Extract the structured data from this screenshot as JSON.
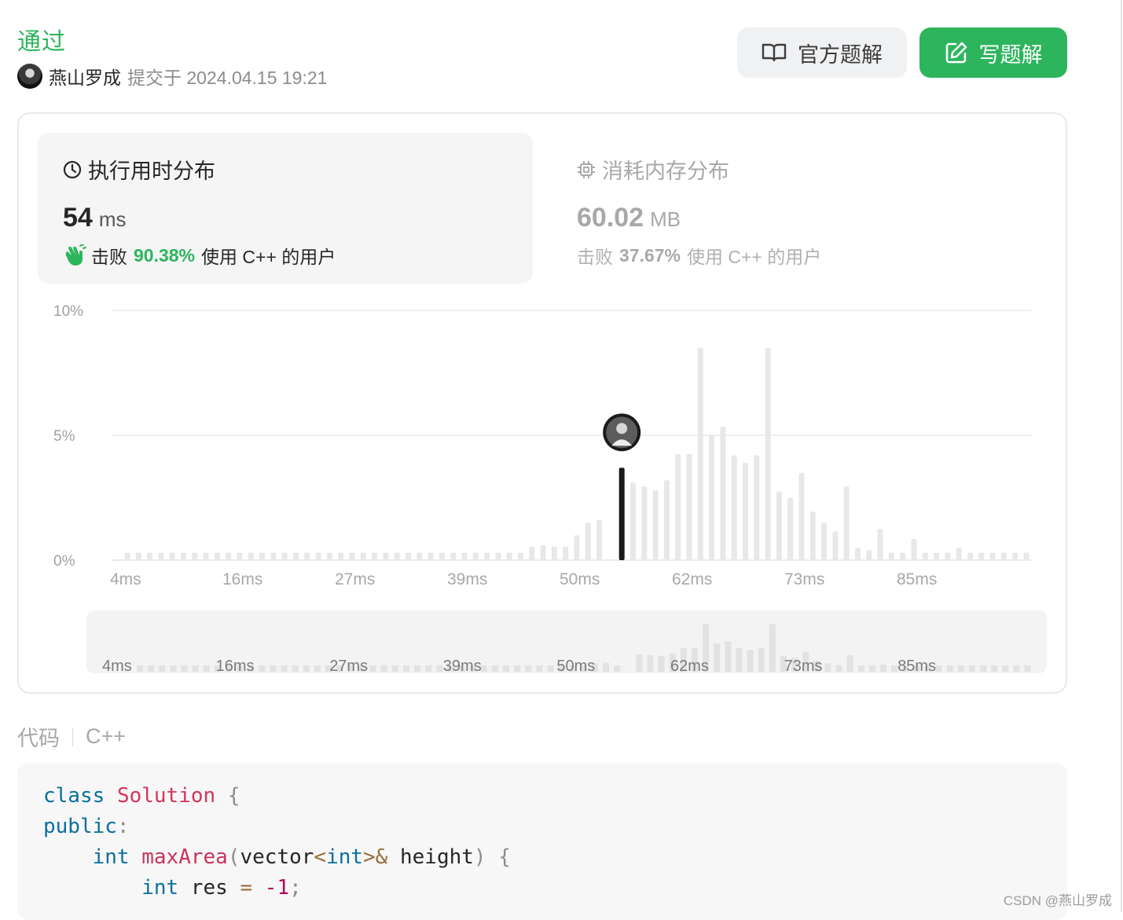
{
  "status": "通过",
  "submission": {
    "author": "燕山罗成",
    "submitted_text": "提交于 2024.04.15 19:21"
  },
  "buttons": {
    "official_solution": "官方题解",
    "write_solution": "写题解"
  },
  "runtime": {
    "title": "执行用时分布",
    "value": "54",
    "unit": "ms",
    "beat_prefix": "击败",
    "beat_percent": "90.38%",
    "beat_suffix": "使用 C++ 的用户"
  },
  "memory": {
    "title": "消耗内存分布",
    "value": "60.02",
    "unit": "MB",
    "beat_prefix": "击败",
    "beat_percent": "37.67%",
    "beat_suffix": "使用 C++ 的用户"
  },
  "chart_data": {
    "type": "bar",
    "y_ticks": [
      "10%",
      "5%",
      "0%"
    ],
    "ylim": [
      0,
      10
    ],
    "x_tick_labels": [
      "4ms",
      "16ms",
      "27ms",
      "39ms",
      "50ms",
      "62ms",
      "73ms",
      "85ms"
    ],
    "highlight_index": 44,
    "highlight_color": "#1a1a1a",
    "bar_color": "#e8e8e8",
    "values": [
      0.3,
      0.3,
      0.3,
      0.3,
      0.3,
      0.3,
      0.3,
      0.3,
      0.3,
      0.3,
      0.3,
      0.3,
      0.3,
      0.3,
      0.3,
      0.3,
      0.3,
      0.3,
      0.3,
      0.3,
      0.3,
      0.3,
      0.3,
      0.3,
      0.3,
      0.3,
      0.3,
      0.3,
      0.3,
      0.3,
      0.3,
      0.3,
      0.3,
      0.3,
      0.3,
      0.3,
      0.55,
      0.6,
      0.55,
      0.55,
      1.0,
      1.5,
      1.6,
      0.0,
      3.7,
      3.1,
      2.95,
      2.8,
      3.2,
      4.25,
      4.25,
      8.5,
      5.0,
      5.35,
      4.2,
      3.9,
      4.2,
      8.5,
      2.75,
      2.5,
      3.5,
      1.95,
      1.5,
      1.15,
      2.95,
      0.5,
      0.4,
      1.25,
      0.3,
      0.3,
      0.85,
      0.3,
      0.3,
      0.3,
      0.5,
      0.3,
      0.3,
      0.3,
      0.3,
      0.3,
      0.3
    ]
  },
  "code": {
    "header_label": "代码",
    "language": "C++",
    "lines": [
      [
        {
          "t": "class",
          "c": "kw"
        },
        {
          "t": " "
        },
        {
          "t": "Solution",
          "c": "cls"
        },
        {
          "t": " {",
          "c": "punc"
        }
      ],
      [
        {
          "t": "public",
          "c": "kw"
        },
        {
          "t": ":",
          "c": "punc"
        }
      ],
      [
        {
          "t": "    "
        },
        {
          "t": "int",
          "c": "kw"
        },
        {
          "t": " "
        },
        {
          "t": "maxArea",
          "c": "fn"
        },
        {
          "t": "(",
          "c": "punc"
        },
        {
          "t": "vector"
        },
        {
          "t": "<",
          "c": "op"
        },
        {
          "t": "int",
          "c": "kw"
        },
        {
          "t": ">&",
          "c": "op"
        },
        {
          "t": " height"
        },
        {
          "t": ")",
          "c": "punc"
        },
        {
          "t": " {",
          "c": "punc"
        }
      ],
      [
        {
          "t": "        "
        },
        {
          "t": "int",
          "c": "kw"
        },
        {
          "t": " res "
        },
        {
          "t": "=",
          "c": "op"
        },
        {
          "t": " "
        },
        {
          "t": "-1",
          "c": "num"
        },
        {
          "t": ";",
          "c": "punc"
        }
      ]
    ]
  },
  "watermark": "CSDN @燕山罗成"
}
